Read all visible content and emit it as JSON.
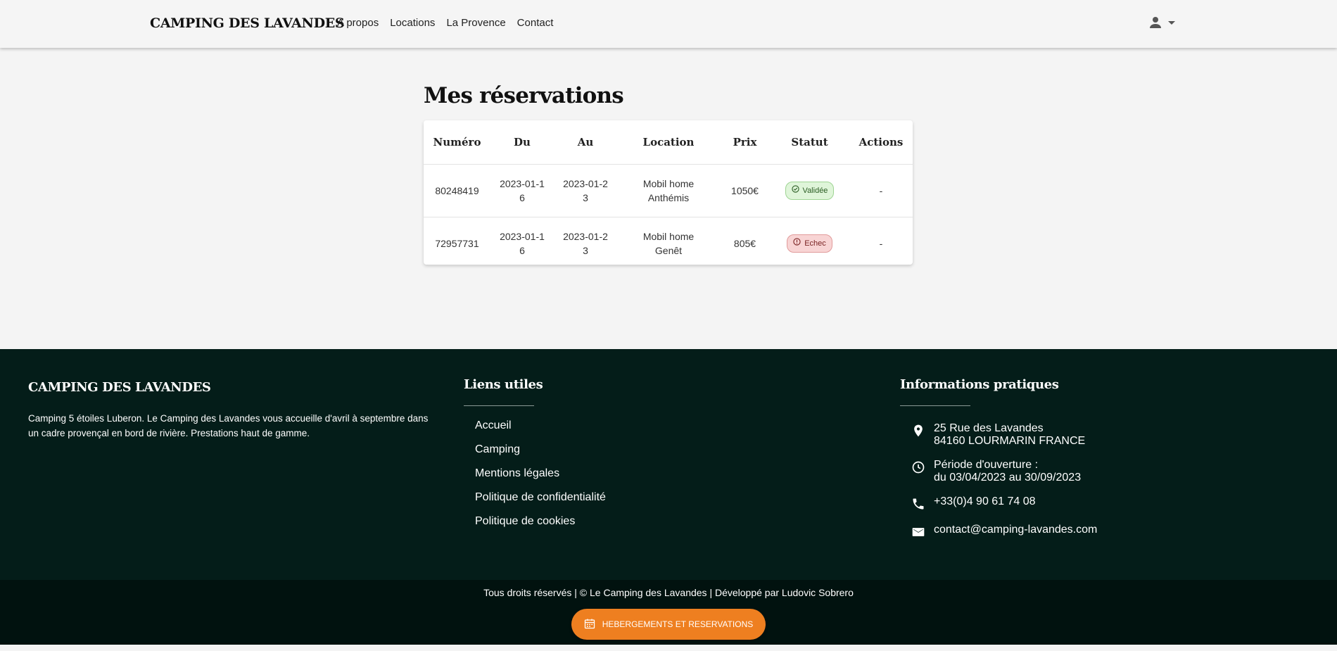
{
  "header": {
    "brand": "CAMPING DES LAVANDES",
    "nav": [
      "A propos",
      "Locations",
      "La Provence",
      "Contact"
    ],
    "user_icon": "person-icon",
    "menu_icon": "caret-down-icon"
  },
  "main": {
    "title": "Mes réservations",
    "table": {
      "headers": [
        "Numéro",
        "Du",
        "Au",
        "Location",
        "Prix",
        "Statut",
        "Actions"
      ],
      "rows": [
        {
          "numero": "80248419",
          "du": "2023-01-16",
          "au": "2023-01-23",
          "location": "Mobil home Anthémis",
          "prix": "1050€",
          "statut": "Validée",
          "actions": "-"
        },
        {
          "numero": "72957731",
          "du": "2023-01-16",
          "au": "2023-01-23",
          "location": "Mobil home Genêt",
          "prix": "805€",
          "statut": "Echec",
          "actions": "-"
        }
      ]
    }
  },
  "footer": {
    "brand": "CAMPING DES LAVANDES",
    "description": "Camping 5 étoiles Luberon. Le Camping des Lavandes vous accueille d'avril à septembre dans un cadre provençal en bord de rivière. Prestations haut de gamme.",
    "links_title": "Liens utiles",
    "links": [
      "Accueil",
      "Camping",
      "Mentions légales",
      "Politique de confidentialité",
      "Politique de cookies"
    ],
    "info_title": "Informations pratiques",
    "address_line1": "25 Rue des Lavandes",
    "address_line2": "84160 LOURMARIN FRANCE",
    "hours_line1": "Période d'ouverture :",
    "hours_line2": "du 03/04/2023 au 30/09/2023",
    "phone": "+33(0)4 90 61 74 08",
    "email": "contact@camping-lavandes.com",
    "copyright": "Tous droits réservés | © Le Camping des Lavandes | Développé par Ludovic Sobrero",
    "cta_label": "HEBERGEMENTS ET RESERVATIONS"
  },
  "colors": {
    "footer_bg": "#041d19",
    "bottom_bg": "#01120f",
    "cta": "#ee7f20",
    "valid_badge": "#dff5d9",
    "fail_badge": "#f8d4d4"
  }
}
